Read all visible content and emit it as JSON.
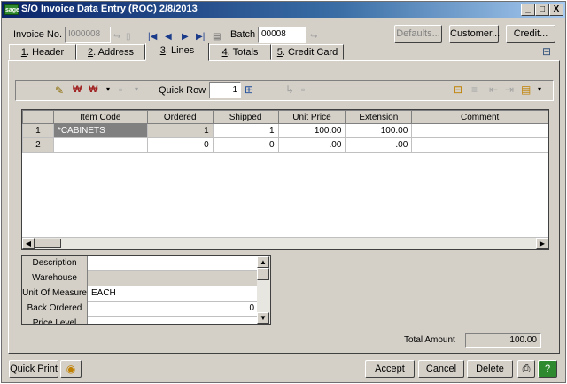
{
  "window": {
    "title": "S/O Invoice Data Entry (ROC) 2/8/2013",
    "app_icon": "sage",
    "minimize": "_",
    "maximize": "□",
    "close": "X"
  },
  "toolbar": {
    "invoice_label": "Invoice No.",
    "invoice_value": "I000008",
    "batch_label": "Batch",
    "batch_value": "00008",
    "defaults_label": "Defaults...",
    "customer_label": "Customer...",
    "credit_label": "Credit..."
  },
  "tabs": [
    {
      "key": "1",
      "label": ". Header"
    },
    {
      "key": "2",
      "label": ". Address"
    },
    {
      "key": "3",
      "label": ". Lines"
    },
    {
      "key": "4",
      "label": ". Totals"
    },
    {
      "key": "5",
      "label": ". Credit Card"
    }
  ],
  "lines_toolbar": {
    "quick_row_label": "Quick Row",
    "quick_row_value": "1"
  },
  "grid": {
    "columns": [
      "Item Code",
      "Ordered",
      "Shipped",
      "Unit Price",
      "Extension",
      "Comment"
    ],
    "rows": [
      {
        "num": "1",
        "item": "*CABINETS",
        "ordered": "1",
        "shipped": "1",
        "unit_price": "100.00",
        "extension": "100.00",
        "comment": ""
      },
      {
        "num": "2",
        "item": "",
        "ordered": "0",
        "shipped": "0",
        "unit_price": ".00",
        "extension": ".00",
        "comment": ""
      }
    ]
  },
  "detail": {
    "rows": [
      {
        "label": "Description",
        "value": ""
      },
      {
        "label": "Warehouse",
        "value": ""
      },
      {
        "label": "Unit Of Measure",
        "value": "EACH"
      },
      {
        "label": "Back Ordered",
        "value": "0"
      },
      {
        "label": "Price Level",
        "value": ""
      }
    ]
  },
  "totals": {
    "label": "Total Amount",
    "value": "100.00"
  },
  "footer": {
    "quick_print": "Quick Print",
    "accept": "Accept",
    "cancel": "Cancel",
    "delete": "Delete"
  }
}
